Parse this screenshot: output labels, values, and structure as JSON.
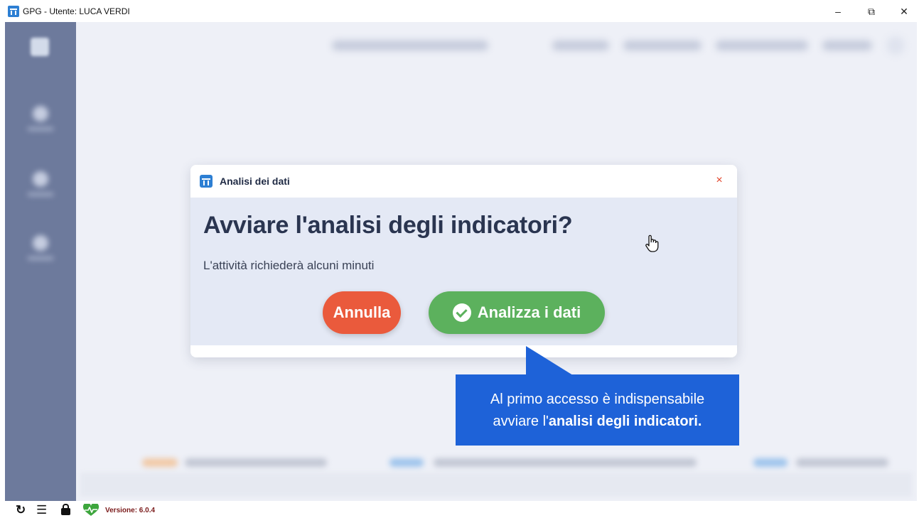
{
  "window": {
    "title": "GPG - Utente: LUCA VERDI",
    "minimize": "–",
    "maximize": "⧉",
    "close": "✕"
  },
  "dialog": {
    "title": "Analisi dei dati",
    "close_label": "×",
    "heading": "Avviare l'analisi degli indicatori?",
    "subtitle": "L'attività richiederà alcuni minuti",
    "cancel_label": "Annulla",
    "confirm_label": "Analizza i dati"
  },
  "callout": {
    "line1": "Al primo accesso è indispensabile",
    "line2_prefix": "avviare l'",
    "line2_bold": "analisi degli indicatori."
  },
  "statusbar": {
    "refresh_glyph": "↻",
    "menu_glyph": "☰",
    "version": "Versione: 6.0.4"
  },
  "icons": {
    "app": "app-logo-icon",
    "dialog": "app-logo-icon",
    "check": "check-circle-icon",
    "cursor": "hand-pointer-icon",
    "heart": "heartbeat-icon",
    "lock": "lock-icon",
    "refresh": "refresh-icon",
    "menu": "hamburger-menu-icon"
  },
  "colors": {
    "cancel": "#ea5a3c",
    "confirm": "#5cb15d",
    "callout": "#1e62d8",
    "close_x": "#e2452b",
    "heart": "#3da63d"
  }
}
